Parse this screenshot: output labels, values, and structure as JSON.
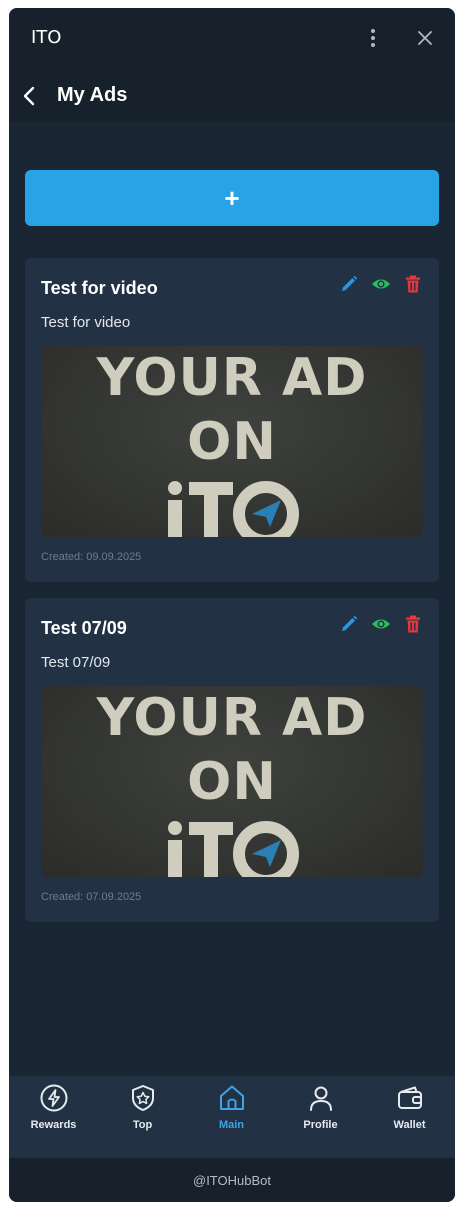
{
  "window": {
    "title": "ITO"
  },
  "header": {
    "title": "My Ads"
  },
  "add_button": {
    "label": "+"
  },
  "ads": [
    {
      "title": "Test for video",
      "description": "Test for video",
      "image_text": [
        "YOUR AD",
        "ON"
      ],
      "image_logo": "iTO",
      "created": "Created: 09.09.2025"
    },
    {
      "title": "Test 07/09",
      "description": "Test 07/09",
      "image_text": [
        "YOUR AD",
        "ON"
      ],
      "image_logo": "iTO",
      "created": "Created: 07.09.2025"
    }
  ],
  "card_action_icons": [
    "edit-icon",
    "eye-icon",
    "trash-icon"
  ],
  "bottom_nav": [
    {
      "label": "Rewards",
      "icon": "lightning-icon",
      "active": false
    },
    {
      "label": "Top",
      "icon": "star-badge-icon",
      "active": false
    },
    {
      "label": "Main",
      "icon": "home-icon",
      "active": true
    },
    {
      "label": "Profile",
      "icon": "user-icon",
      "active": false
    },
    {
      "label": "Wallet",
      "icon": "wallet-icon",
      "active": false
    }
  ],
  "footer": {
    "text": "@ITOHubBot"
  },
  "colors": {
    "background": "#17212b",
    "content": "#1a2633",
    "card": "#223144",
    "accent": "#27a3e6",
    "edit": "#2f93e0",
    "view": "#27c35a",
    "delete": "#e5373d"
  }
}
